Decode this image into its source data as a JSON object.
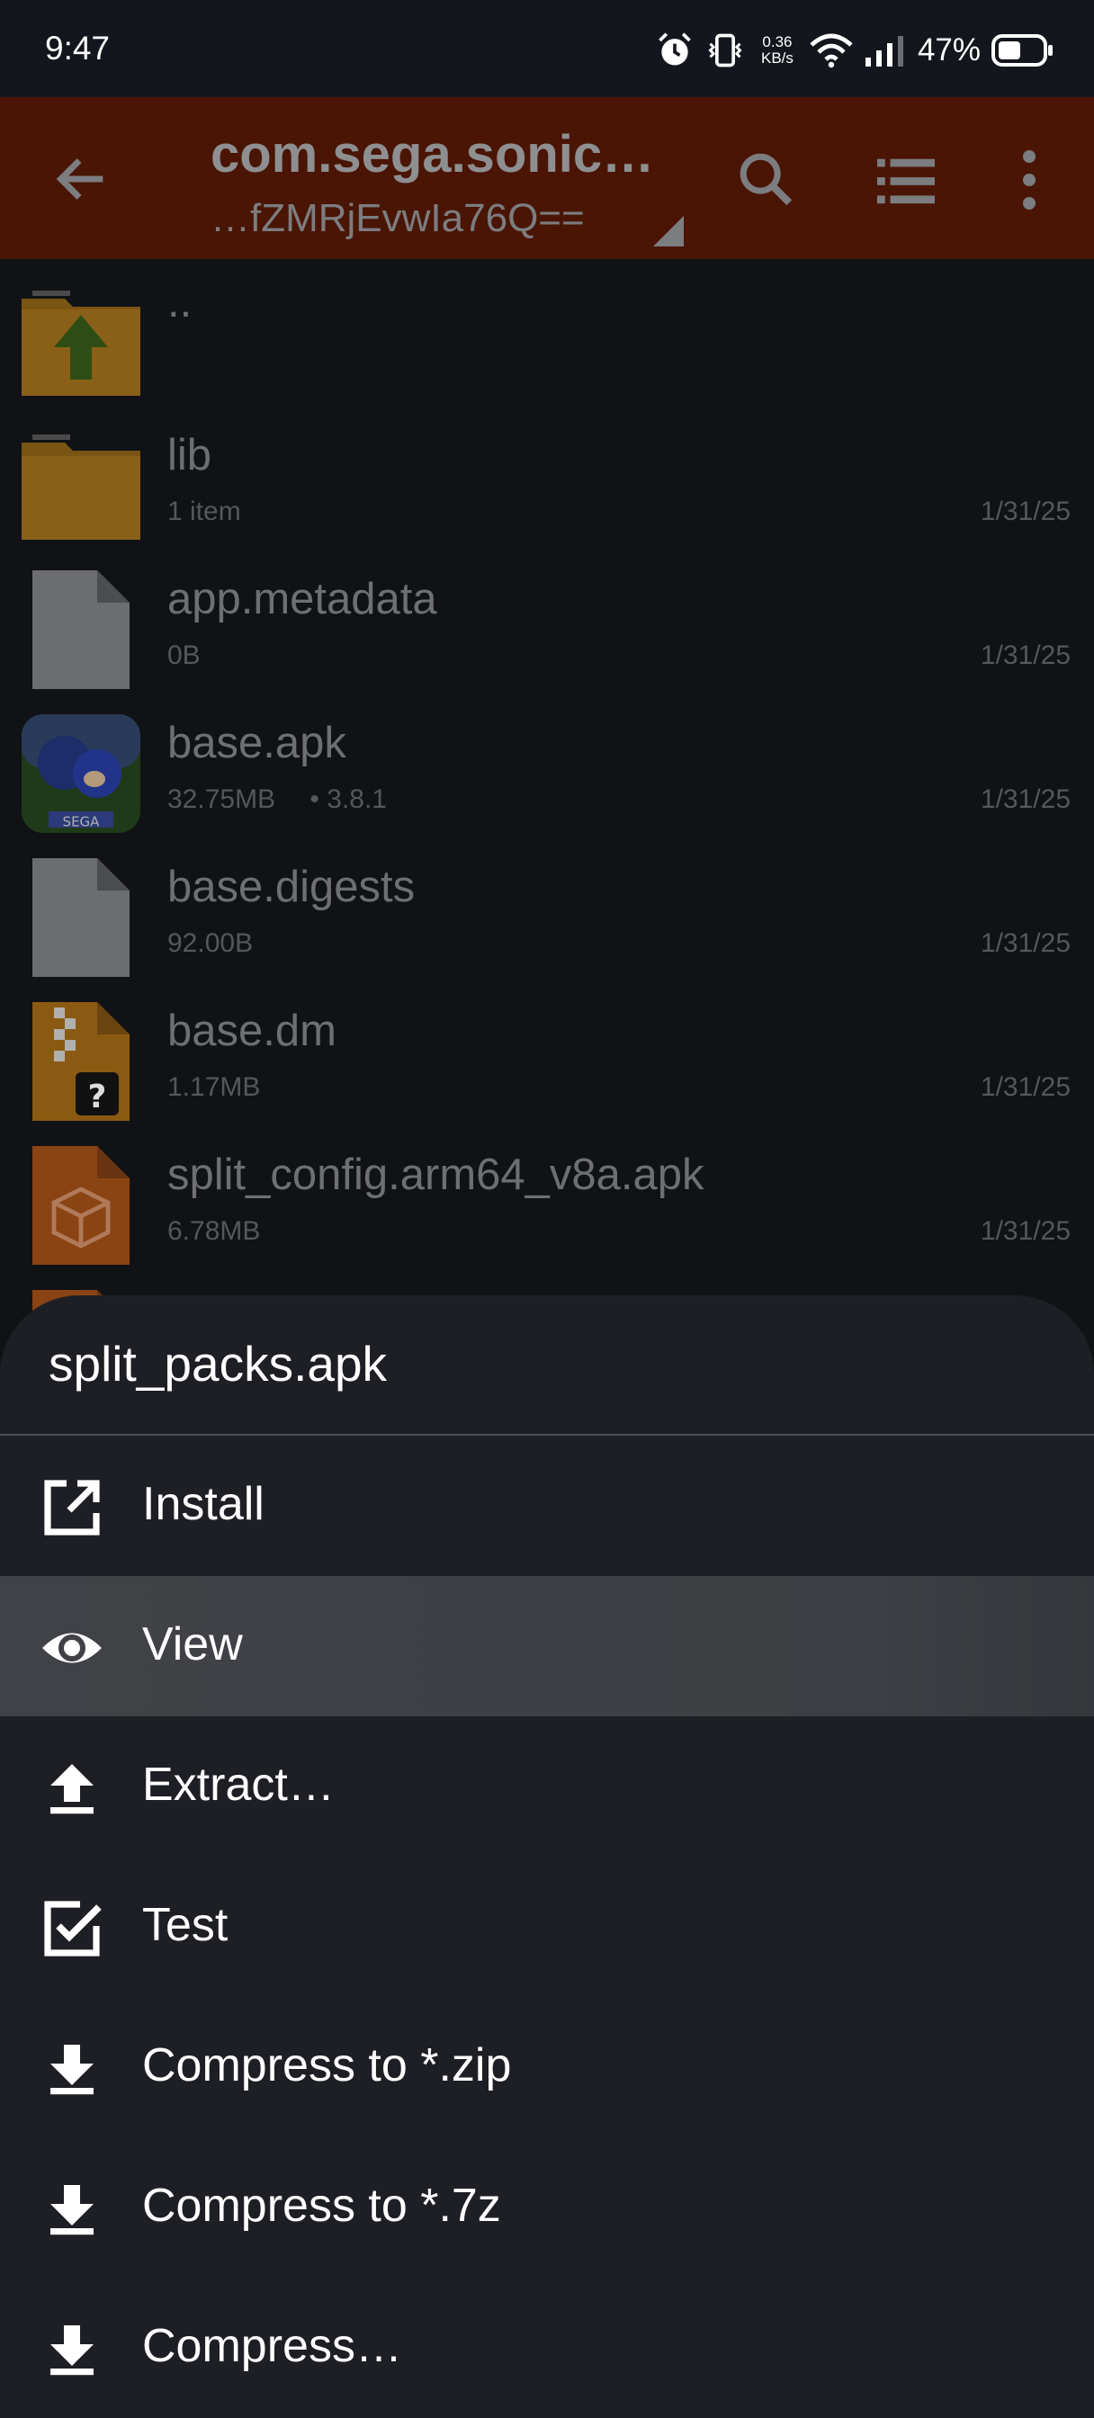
{
  "status_bar": {
    "time": "9:47",
    "net_speed_value": "0.36",
    "net_speed_unit": "KB/s",
    "battery": "47%",
    "icons": [
      "alarm-icon",
      "vibrate-icon",
      "wifi-icon",
      "signal-icon",
      "battery-icon"
    ]
  },
  "app_bar": {
    "title": "com.sega.sonic…",
    "subtitle": "…fZMRjEvwIa76Q==",
    "icons": [
      "back-arrow-icon",
      "search-icon",
      "list-view-icon",
      "more-vert-icon"
    ],
    "color": "#4a1505"
  },
  "files": [
    {
      "name": "..",
      "meta": "",
      "extra": "",
      "date": "",
      "icon": "folder-up-icon"
    },
    {
      "name": "lib",
      "meta": "1 item",
      "extra": "",
      "date": "1/31/25",
      "icon": "folder-icon"
    },
    {
      "name": "app.metadata",
      "meta": "0B",
      "extra": "",
      "date": "1/31/25",
      "icon": "file-icon"
    },
    {
      "name": "base.apk",
      "meta": "32.75MB",
      "extra": "• 3.8.1",
      "date": "1/31/25",
      "icon": "sonic-app-icon"
    },
    {
      "name": "base.digests",
      "meta": "92.00B",
      "extra": "",
      "date": "1/31/25",
      "icon": "file-icon"
    },
    {
      "name": "base.dm",
      "meta": "1.17MB",
      "extra": "",
      "date": "1/31/25",
      "icon": "unknown-archive-icon"
    },
    {
      "name": "split_config.arm64_v8a.apk",
      "meta": "6.78MB",
      "extra": "",
      "date": "1/31/25",
      "icon": "apk-package-icon"
    }
  ],
  "sheet": {
    "title": "split_packs.apk",
    "items": [
      {
        "label": "Install",
        "icon": "open-external-icon"
      },
      {
        "label": "View",
        "icon": "eye-icon",
        "highlighted": true
      },
      {
        "label": "Extract…",
        "icon": "upload-icon"
      },
      {
        "label": "Test",
        "icon": "checkbox-icon"
      },
      {
        "label": "Compress to *.zip",
        "icon": "download-icon"
      },
      {
        "label": "Compress to *.7z",
        "icon": "download-icon"
      },
      {
        "label": "Compress…",
        "icon": "download-icon"
      }
    ]
  }
}
